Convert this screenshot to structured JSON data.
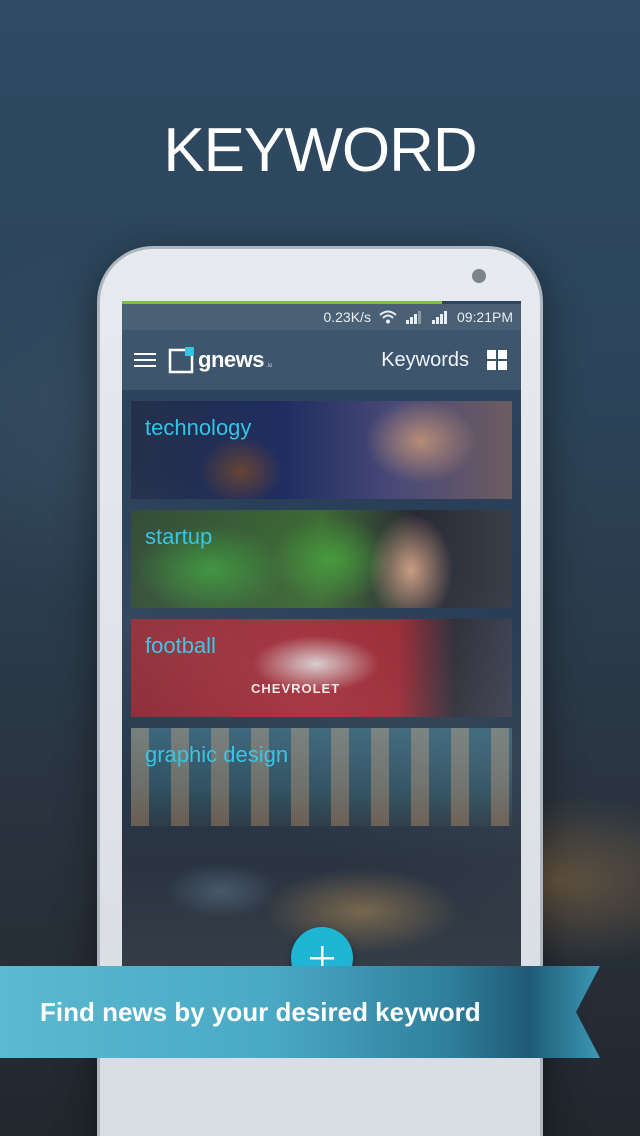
{
  "headline": "KEYWORD",
  "status_bar": {
    "speed": "0.23K/s",
    "time": "09:21PM",
    "icons": [
      "wifi-icon",
      "signal-icon",
      "signal-icon"
    ]
  },
  "app_bar": {
    "logo_text": "gnews",
    "logo_suffix": ".io",
    "title": "Keywords",
    "menu_icon": "hamburger-menu-icon",
    "grid_icon": "grid-view-icon"
  },
  "keywords": [
    {
      "label": "technology"
    },
    {
      "label": "startup"
    },
    {
      "label": "football",
      "image_text": "CHEVROLET"
    },
    {
      "label": "graphic design"
    }
  ],
  "fab": {
    "icon": "plus-icon"
  },
  "ribbon": {
    "text": "Find news by your desired keyword"
  },
  "colors": {
    "accent": "#35c3e3",
    "fab": "#1fb6d6",
    "app_bar": "#3d556d",
    "status_bar": "#4a6075",
    "load_bar": "#7ac143"
  }
}
